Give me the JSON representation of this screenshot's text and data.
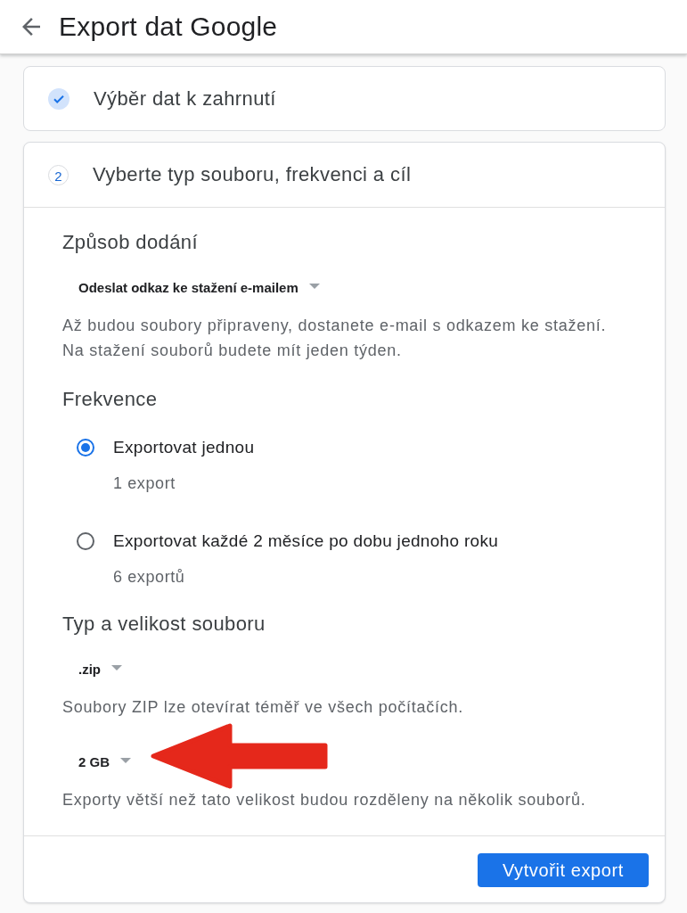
{
  "header": {
    "title": "Export dat Google"
  },
  "steps": [
    {
      "kind": "done",
      "title": "Výběr dat k zahrnutí",
      "expanded": false
    },
    {
      "kind": "numbered",
      "number": "2",
      "title": "Vyberte typ souboru, frekvenci a cíl",
      "expanded": true,
      "sections": [
        {
          "heading": "Způsob dodání",
          "items": [
            {
              "kind": "dropdown",
              "value": "Odeslat odkaz ke stažení e-mailem",
              "pointed_at": false
            },
            {
              "kind": "note",
              "text": "Až budou soubory připraveny, dostanete e-mail s odkazem ke stažení.\nNa stažení souborů budete mít jeden týden."
            }
          ]
        },
        {
          "heading": "Frekvence",
          "items": [
            {
              "kind": "radio",
              "label": "Exportovat jednou",
              "detail": "1 export",
              "selected": true
            },
            {
              "kind": "radio",
              "label": "Exportovat každé 2 měsíce po dobu jednoho roku",
              "detail": "6 exportů",
              "selected": false
            }
          ]
        },
        {
          "heading": "Typ a velikost souboru",
          "items": [
            {
              "kind": "dropdown",
              "value": ".zip",
              "pointed_at": false
            },
            {
              "kind": "note",
              "text": "Soubory ZIP lze otevírat téměř ve všech počítačích."
            },
            {
              "kind": "dropdown",
              "value": "2 GB",
              "pointed_at": true
            },
            {
              "kind": "note",
              "text": "Exporty větší než tato velikost budou rozděleny na několik souborů."
            }
          ]
        }
      ],
      "action": {
        "label": "Vytvořit export"
      }
    }
  ]
}
